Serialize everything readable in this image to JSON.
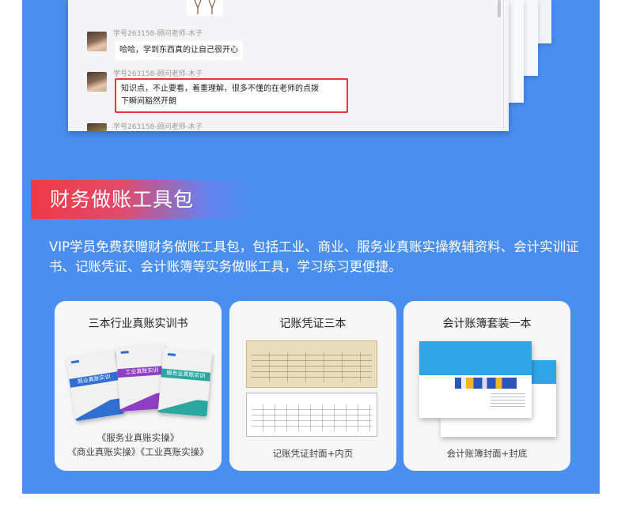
{
  "chat": {
    "messages": [
      {
        "sender": "学号263158-顾问老师-木子",
        "text": "哈哈，学到东西真的让自己很开心",
        "highlighted": false
      },
      {
        "sender": "学号263158-顾问老师-木子",
        "text_line1": "知识点，不止要看，着重理解，很多不懂的在老师的点拨",
        "text_line2": "下瞬间豁然开朗",
        "highlighted": true
      },
      {
        "sender": "学号263158-顾问老师-木子",
        "text": ""
      }
    ],
    "highlight_color": "#e8383d"
  },
  "section": {
    "title": "财务做账工具包",
    "description": "VIP学员免费获赠财务做账工具包，包括工业、商业、服务业真账实操教辅资料、会计实训证书、记账凭证、会计账簿等实务做账工具，学习练习更便捷。"
  },
  "cards": [
    {
      "title": "三本行业真账实训书",
      "caption_line1": "《服务业真账实操》",
      "caption_line2": "《商业真账实操》《工业真账实操》",
      "books": [
        "商业真账实训",
        "工业真账实训",
        "服务业真账实训"
      ]
    },
    {
      "title": "记账凭证三本",
      "caption_line1": "记账凭证封面+内页"
    },
    {
      "title": "会计账簿套装一本",
      "caption_line1": "会计账簿封面+封底"
    }
  ],
  "colors": {
    "panel_bg": "#4a8ef0",
    "title_red": "#ef3a45",
    "card_bg": "#f6f6f6",
    "book_blue": "#2f6fd1",
    "book_purple": "#8e3fc4",
    "book_teal": "#2aa8a0",
    "ledger_blue": "#2ea6e6"
  }
}
